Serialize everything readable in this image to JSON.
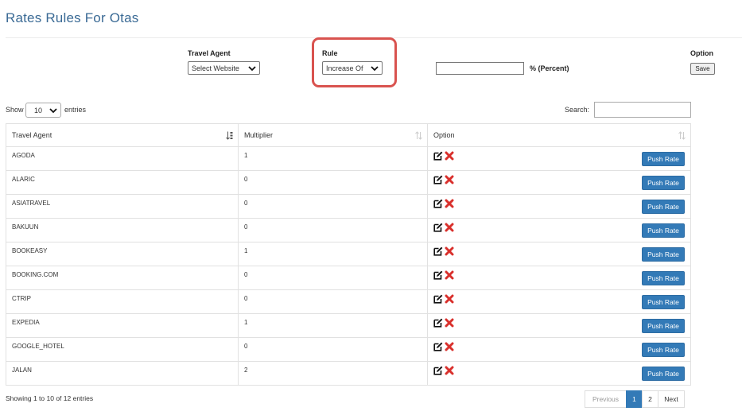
{
  "page": {
    "title": "Rates Rules For Otas"
  },
  "form": {
    "travel_agent_label": "Travel Agent",
    "travel_agent_value": "Select Website",
    "rule_label": "Rule",
    "rule_value": "Increase Of",
    "percent_value": "",
    "percent_label": "%  (Percent)",
    "option_label": "Option",
    "save_label": "Save"
  },
  "table_controls": {
    "show_label": "Show",
    "length_value": "10",
    "entries_label": "entries",
    "search_label": "Search:",
    "search_value": ""
  },
  "table": {
    "columns": [
      "Travel Agent",
      "Multiplier",
      "Option"
    ],
    "push_label": "Push Rate",
    "rows": [
      {
        "agent": "AGODA",
        "multiplier": "1"
      },
      {
        "agent": "ALARIC",
        "multiplier": "0"
      },
      {
        "agent": "ASIATRAVEL",
        "multiplier": "0"
      },
      {
        "agent": "BAKUUN",
        "multiplier": "0"
      },
      {
        "agent": "BOOKEASY",
        "multiplier": "1"
      },
      {
        "agent": "BOOKING.COM",
        "multiplier": "0"
      },
      {
        "agent": "CTRIP",
        "multiplier": "0"
      },
      {
        "agent": "EXPEDIA",
        "multiplier": "1"
      },
      {
        "agent": "GOOGLE_HOTEL",
        "multiplier": "0"
      },
      {
        "agent": "JALAN",
        "multiplier": "2"
      }
    ]
  },
  "footer": {
    "info": "Showing 1 to 10 of 12 entries",
    "pagination": {
      "previous": "Previous",
      "page1": "1",
      "page2": "2",
      "next": "Next"
    }
  },
  "colors": {
    "accent": "#337ab7",
    "title": "#3a6a95",
    "highlight": "#d9534f",
    "delete": "#d9302c"
  }
}
